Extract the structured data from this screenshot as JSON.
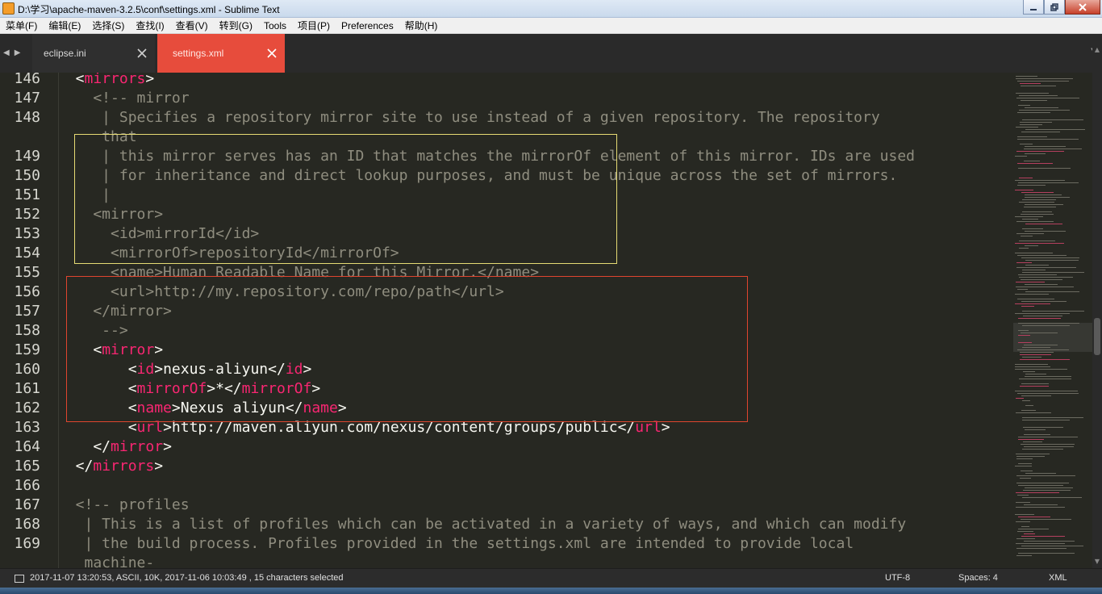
{
  "window": {
    "title": "D:\\学习\\apache-maven-3.2.5\\conf\\settings.xml - Sublime Text"
  },
  "menu": [
    {
      "label": "菜单(F)"
    },
    {
      "label": "编辑(E)"
    },
    {
      "label": "选择(S)"
    },
    {
      "label": "查找(I)"
    },
    {
      "label": "查看(V)"
    },
    {
      "label": "转到(G)"
    },
    {
      "label": "Tools"
    },
    {
      "label": "项目(P)"
    },
    {
      "label": "Preferences"
    },
    {
      "label": "帮助(H)"
    }
  ],
  "tabs": [
    {
      "label": "eclipse.ini",
      "active": false
    },
    {
      "label": "settings.xml",
      "active": true
    }
  ],
  "colors": {
    "active_tab": "#e74c3c",
    "editor_bg": "#272822",
    "tag": "#f92672",
    "comment": "#8f8d7f",
    "yellow_box": "#e6db74",
    "red_box": "#e0452e"
  },
  "editor": {
    "gutter": [
      "146",
      "147",
      "148",
      "",
      "149",
      "150",
      "151",
      "152",
      "153",
      "154",
      "155",
      "156",
      "157",
      "158",
      "159",
      "160",
      "161",
      "162",
      "163",
      "164",
      "165",
      "166",
      "167",
      "168",
      "169",
      ""
    ],
    "lines": [
      [
        {
          "c": "pn",
          "t": "  <"
        },
        {
          "c": "tg",
          "t": "mirrors"
        },
        {
          "c": "pn",
          "t": ">"
        }
      ],
      [
        {
          "c": "cm",
          "t": "    <!-- mirror"
        }
      ],
      [
        {
          "c": "cm",
          "t": "     | Specifies a repository mirror site to use instead of a given repository. The repository"
        }
      ],
      [
        {
          "c": "cm",
          "t": "     that"
        }
      ],
      [
        {
          "c": "cm",
          "t": "     | this mirror serves has an ID that matches the mirrorOf element of this mirror. IDs are used"
        }
      ],
      [
        {
          "c": "cm",
          "t": "     | for inheritance and direct lookup purposes, and must be unique across the set of mirrors."
        }
      ],
      [
        {
          "c": "cm",
          "t": "     |"
        }
      ],
      [
        {
          "c": "cm",
          "t": "    <mirror>"
        }
      ],
      [
        {
          "c": "cm",
          "t": "      <id>mirrorId</id>"
        }
      ],
      [
        {
          "c": "cm",
          "t": "      <mirrorOf>repositoryId</mirrorOf>"
        }
      ],
      [
        {
          "c": "cm",
          "t": "      <name>Human Readable Name for this Mirror.</name>"
        }
      ],
      [
        {
          "c": "cm",
          "t": "      <url>http://my.repository.com/repo/path</url>"
        }
      ],
      [
        {
          "c": "cm",
          "t": "    </mirror>"
        }
      ],
      [
        {
          "c": "cm",
          "t": "     -->"
        }
      ],
      [
        {
          "c": "pn",
          "t": "    <"
        },
        {
          "c": "tg",
          "t": "mirror"
        },
        {
          "c": "pn",
          "t": ">"
        }
      ],
      [
        {
          "c": "pn",
          "t": "        <"
        },
        {
          "c": "tg",
          "t": "id"
        },
        {
          "c": "pn",
          "t": ">"
        },
        {
          "c": "tx",
          "t": "nexus-aliyun"
        },
        {
          "c": "pn",
          "t": "</"
        },
        {
          "c": "tg",
          "t": "id"
        },
        {
          "c": "pn",
          "t": ">"
        }
      ],
      [
        {
          "c": "pn",
          "t": "        <"
        },
        {
          "c": "tg",
          "t": "mirrorOf"
        },
        {
          "c": "pn",
          "t": ">"
        },
        {
          "c": "tx",
          "t": "*"
        },
        {
          "c": "pn",
          "t": "</"
        },
        {
          "c": "tg",
          "t": "mirrorOf"
        },
        {
          "c": "pn",
          "t": ">"
        }
      ],
      [
        {
          "c": "pn",
          "t": "        <"
        },
        {
          "c": "tg",
          "t": "name"
        },
        {
          "c": "pn",
          "t": ">"
        },
        {
          "c": "tx",
          "t": "Nexus aliyun"
        },
        {
          "c": "pn",
          "t": "</"
        },
        {
          "c": "tg",
          "t": "name"
        },
        {
          "c": "pn",
          "t": ">"
        }
      ],
      [
        {
          "c": "pn",
          "t": "        <"
        },
        {
          "c": "tg",
          "t": "url"
        },
        {
          "c": "pn",
          "t": ">"
        },
        {
          "c": "tx",
          "t": "http://maven.aliyun.com/nexus/content/groups/public"
        },
        {
          "c": "pn",
          "t": "</"
        },
        {
          "c": "tg",
          "t": "url"
        },
        {
          "c": "pn",
          "t": ">"
        }
      ],
      [
        {
          "c": "pn",
          "t": "    </"
        },
        {
          "c": "tg",
          "t": "mirror"
        },
        {
          "c": "pn",
          "t": ">"
        }
      ],
      [
        {
          "c": "pn",
          "t": "  </"
        },
        {
          "c": "tg",
          "t": "mirrors"
        },
        {
          "c": "pn",
          "t": ">"
        }
      ],
      [
        {
          "c": "pn",
          "t": ""
        }
      ],
      [
        {
          "c": "cm",
          "t": "  <!-- profiles"
        }
      ],
      [
        {
          "c": "cm",
          "t": "   | This is a list of profiles which can be activated in a variety of ways, and which can modify"
        }
      ],
      [
        {
          "c": "cm",
          "t": "   | the build process. Profiles provided in the settings.xml are intended to provide local"
        }
      ],
      [
        {
          "c": "cm",
          "t": "   machine-"
        }
      ]
    ]
  },
  "status": {
    "info": "2017-11-07 13:20:53, ASCII, 10K, 2017-11-06 10:03:49 , 15 characters selected",
    "encoding": "UTF-8",
    "indent": "Spaces: 4",
    "syntax": "XML"
  }
}
